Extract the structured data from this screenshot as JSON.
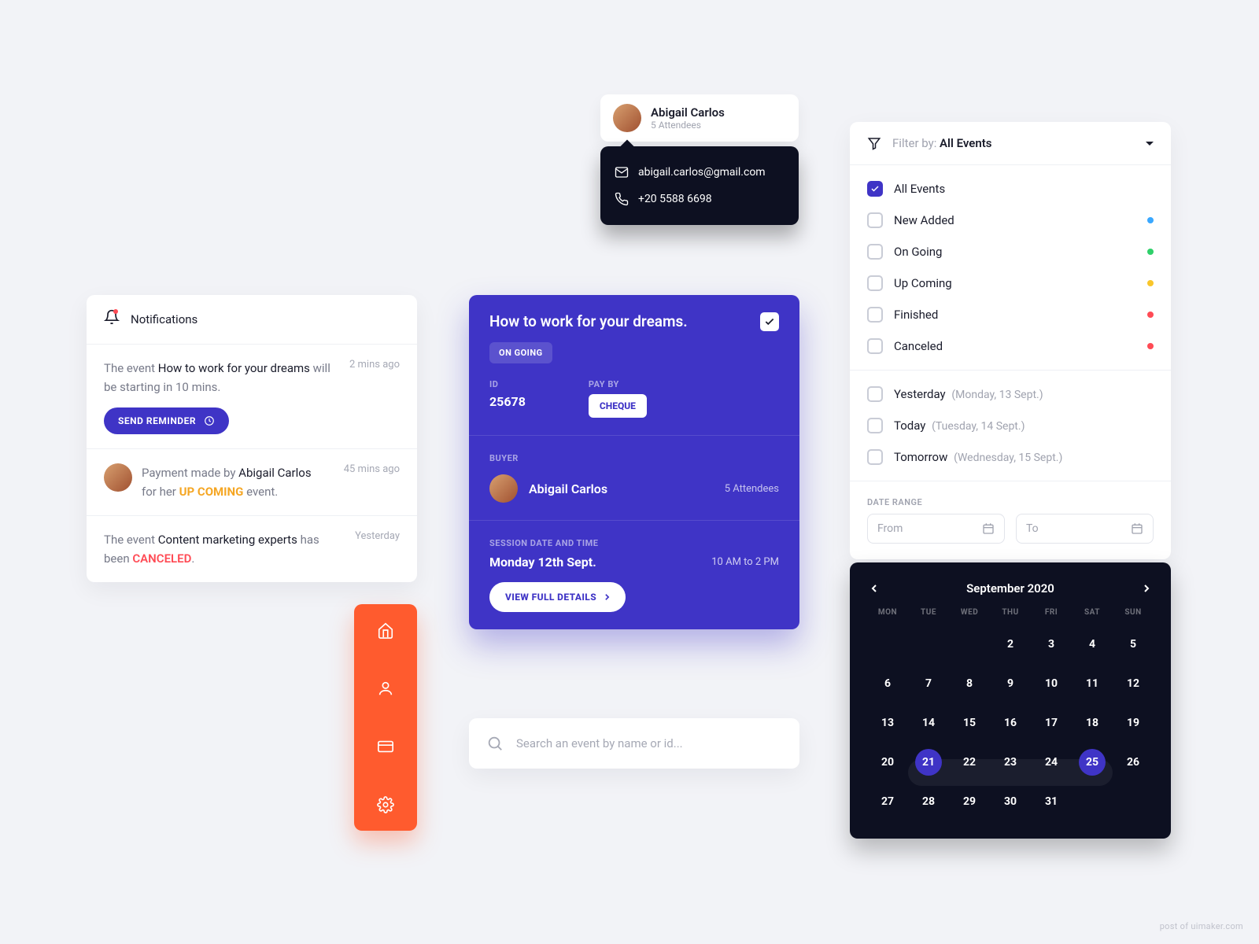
{
  "notifications": {
    "title": "Notifications",
    "items": [
      {
        "prefix": "The event ",
        "strong": "How to work for your dreams",
        "suffix": " will be starting in 10 mins.",
        "time": "2 mins ago",
        "action": "SEND REMINDER"
      },
      {
        "prefix": "Payment made by ",
        "strong": "Abigail Carlos",
        "mid_text": " for her ",
        "highlight": "UP COMING",
        "suffix2": " event.",
        "time": "45 mins ago",
        "has_avatar": true
      },
      {
        "prefix": "The event ",
        "strong": "Content marketing experts",
        "mid_text": " has been ",
        "highlight_cancel": "CANCELED",
        "suffix2": ".",
        "time": "Yesterday"
      }
    ]
  },
  "contact": {
    "name": "Abigail Carlos",
    "attendees": "5 Attendees",
    "email": "abigail.carlos@gmail.com",
    "phone": "+20 5588 6698"
  },
  "event": {
    "title": "How to work for your dreams.",
    "status": "ON GOING",
    "id_label": "ID",
    "id": "25678",
    "payby_label": "PAY BY",
    "payby": "CHEQUE",
    "buyer_label": "BUYER",
    "buyer": "Abigail Carlos",
    "buyer_attendees": "5 Attendees",
    "session_label": "SESSION DATE AND TIME",
    "session_date": "Monday 12th Sept.",
    "session_time": "10 AM to 2 PM",
    "view_btn": "VIEW FULL DETAILS"
  },
  "search": {
    "placeholder": "Search an event by name or id..."
  },
  "filter": {
    "prefix": "Filter by: ",
    "value": "All Events",
    "status_options": [
      {
        "label": "All Events",
        "checked": true
      },
      {
        "label": "New Added",
        "color": "#3aa8ff"
      },
      {
        "label": "On Going",
        "color": "#2fd06a"
      },
      {
        "label": "Up Coming",
        "color": "#f9c62b"
      },
      {
        "label": "Finished",
        "color": "#ff4b55"
      },
      {
        "label": "Canceled",
        "color": "#ff4b55"
      }
    ],
    "date_options": [
      {
        "label": "Yesterday",
        "sub": "(Monday, 13 Sept.)"
      },
      {
        "label": "Today",
        "sub": "(Tuesday, 14 Sept.)"
      },
      {
        "label": "Tomorrow",
        "sub": "(Wednesday, 15 Sept.)"
      }
    ],
    "range_label": "DATE RANGE",
    "from": "From",
    "to": "To"
  },
  "calendar": {
    "month": "September 2020",
    "weekdays": [
      "MON",
      "TUE",
      "WED",
      "THU",
      "FRI",
      "SAT",
      "SUN"
    ],
    "days": [
      {
        "n": "",
        "dim": true
      },
      {
        "n": "",
        "dim": true
      },
      {
        "n": "",
        "dim": true
      },
      {
        "n": "2"
      },
      {
        "n": "3"
      },
      {
        "n": "4"
      },
      {
        "n": "5"
      },
      {
        "n": "6"
      },
      {
        "n": "7"
      },
      {
        "n": "8"
      },
      {
        "n": "9"
      },
      {
        "n": "10"
      },
      {
        "n": "11"
      },
      {
        "n": "12"
      },
      {
        "n": "13"
      },
      {
        "n": "14"
      },
      {
        "n": "15"
      },
      {
        "n": "16"
      },
      {
        "n": "17"
      },
      {
        "n": "18"
      },
      {
        "n": "19"
      },
      {
        "n": "20"
      },
      {
        "n": "21",
        "sel": true
      },
      {
        "n": "22"
      },
      {
        "n": "23"
      },
      {
        "n": "24"
      },
      {
        "n": "25",
        "sel": true
      },
      {
        "n": "26"
      },
      {
        "n": "27"
      },
      {
        "n": "28"
      },
      {
        "n": "29"
      },
      {
        "n": "30"
      },
      {
        "n": "31"
      },
      {
        "n": "",
        "dim": true
      },
      {
        "n": "",
        "dim": true
      }
    ]
  },
  "watermark": "post of uimaker.com"
}
